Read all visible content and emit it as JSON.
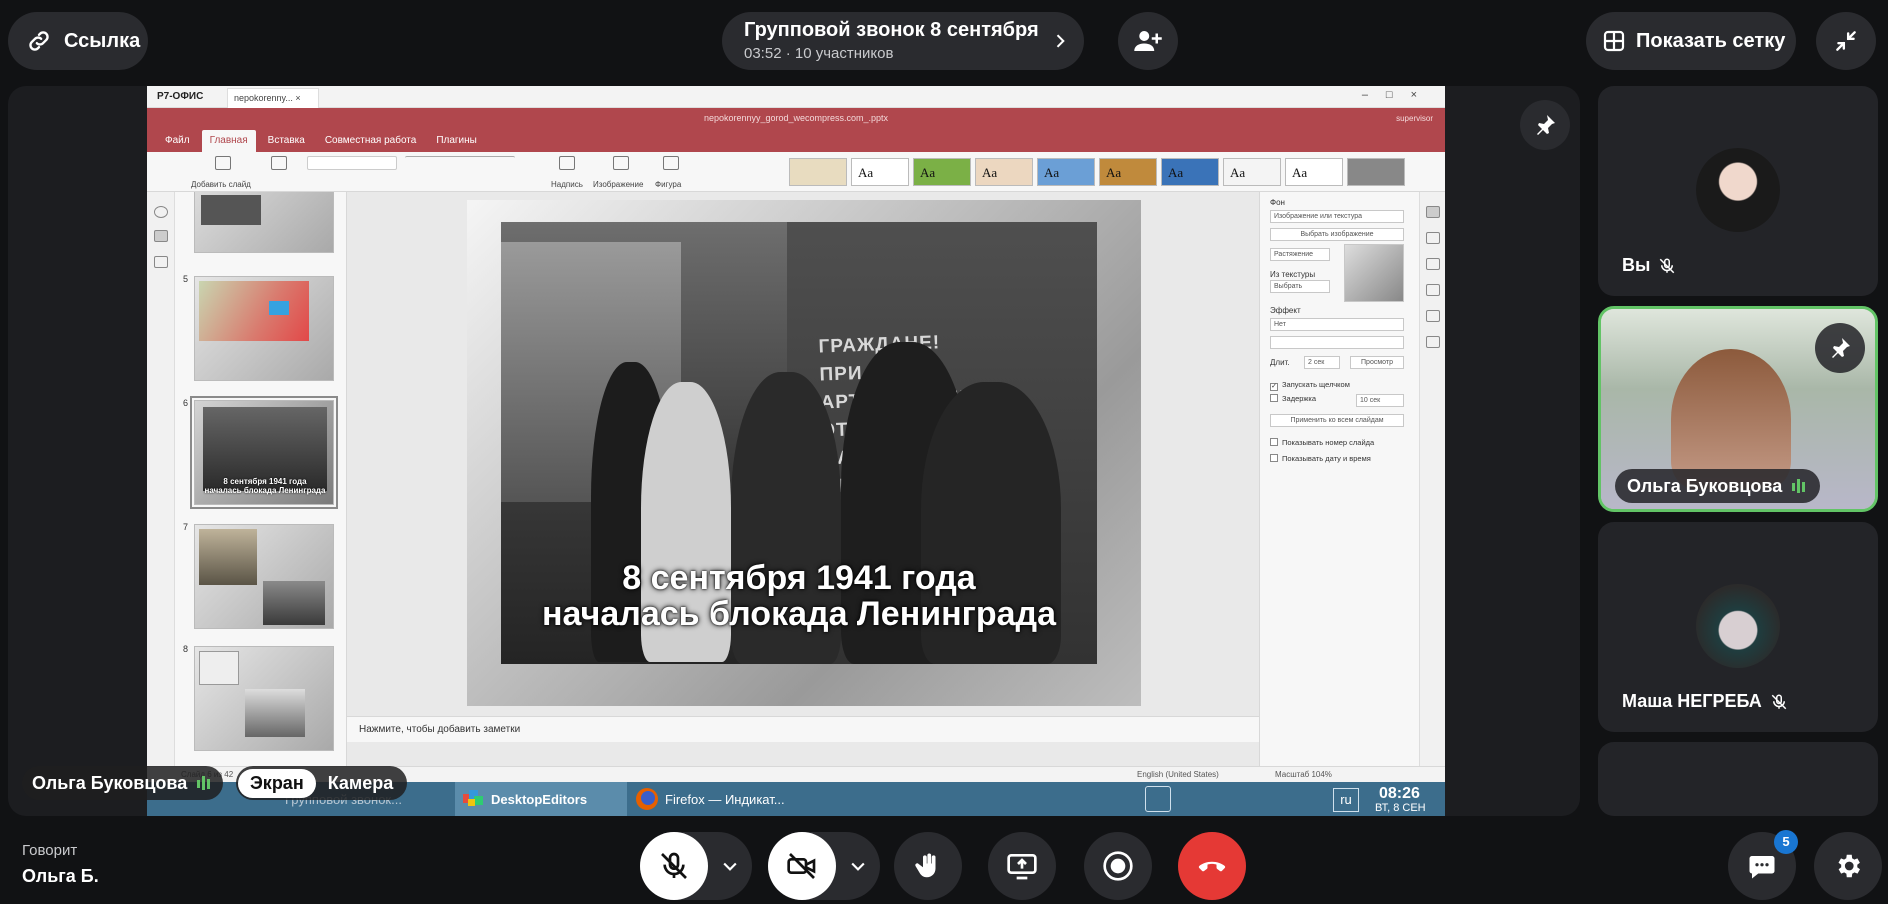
{
  "topbar": {
    "link_label": "Ссылка",
    "call_title": "Групповой звонок 8 сентября",
    "call_subtitle": "03:52 · 10 участников",
    "grid_label": "Показать сетку"
  },
  "shared_screen": {
    "app_name": "Р7-ОФИС",
    "doc_tab": "nepokorenny...",
    "filename": "nepokorennyy_gorod_wecompress.com_.pptx",
    "user": "supervisor",
    "ribbon_tabs": [
      "Файл",
      "Главная",
      "Вставка",
      "Совместная работа",
      "Плагины"
    ],
    "toolbar": {
      "add_slide": "Добавить слайд",
      "caption": "Надпись",
      "image": "Изображение",
      "shape": "Фигура",
      "theme_sample": "Aa"
    },
    "thumbnails": [
      {
        "number": "",
        "caption": ""
      },
      {
        "number": "5",
        "caption": ""
      },
      {
        "number": "6",
        "caption": "8 сентября 1941 года\nначалась блокада Ленинграда"
      },
      {
        "number": "7",
        "caption": ""
      },
      {
        "number": "8",
        "caption": ""
      }
    ],
    "slide": {
      "caption_line1": "8 сентября 1941 года",
      "caption_line2": "началась блокада Ленинграда",
      "wall_text": "ГРАЖДАНЕ!\nПРИ АРТОБСТРЕЛЕ\nЭТА СТОРОНА\nНАИБОЛЕЕ ОПАСНА"
    },
    "notes_placeholder": "Нажмите, чтобы добавить заметки",
    "status": {
      "slide_count": "Слайд 6 из 42",
      "language": "English (United States)",
      "zoom": "Масштаб 104%"
    },
    "settings": {
      "background_label": "Фон",
      "fill_type": "Изображение или текстура",
      "choose_image": "Выбрать изображение",
      "stretch": "Растяжение",
      "from_texture": "Из текстуры",
      "choose": "Выбрать",
      "effect_label": "Эффект",
      "effect_value": "Нет",
      "duration_label": "Длит.",
      "duration_value": "2 сек",
      "preview": "Просмотр",
      "start_on_click": "Запускать щелчком",
      "delay": "Задержка",
      "delay_value": "10 сек",
      "apply_all": "Применить ко всем слайдам",
      "show_slide_number": "Показывать номер слайда",
      "show_date": "Показывать дату и время"
    },
    "taskbar": {
      "ghost_task": "Групповой звонок...",
      "active_task": "DesktopEditors",
      "firefox_task": "Firefox — Индикат...",
      "lang": "ru",
      "time": "08:26",
      "date": "ВТ, 8 СЕН"
    }
  },
  "stage_overlay": {
    "presenter_name": "Ольга Буковцова",
    "screen_label": "Экран",
    "camera_label": "Камера"
  },
  "participants": [
    {
      "name": "Вы",
      "muted": true
    },
    {
      "name": "Ольга Буковцова",
      "speaking": true
    },
    {
      "name": "Маша НЕГРЕБА",
      "muted": true
    }
  ],
  "bottom": {
    "speaking_label": "Говорит",
    "speaking_name": "Ольга Б.",
    "chat_badge": "5"
  },
  "colors": {
    "accent_green": "#62c466",
    "hangup_red": "#e53935",
    "badge_blue": "#1976d2",
    "ribbon_red": "#b0474d"
  }
}
